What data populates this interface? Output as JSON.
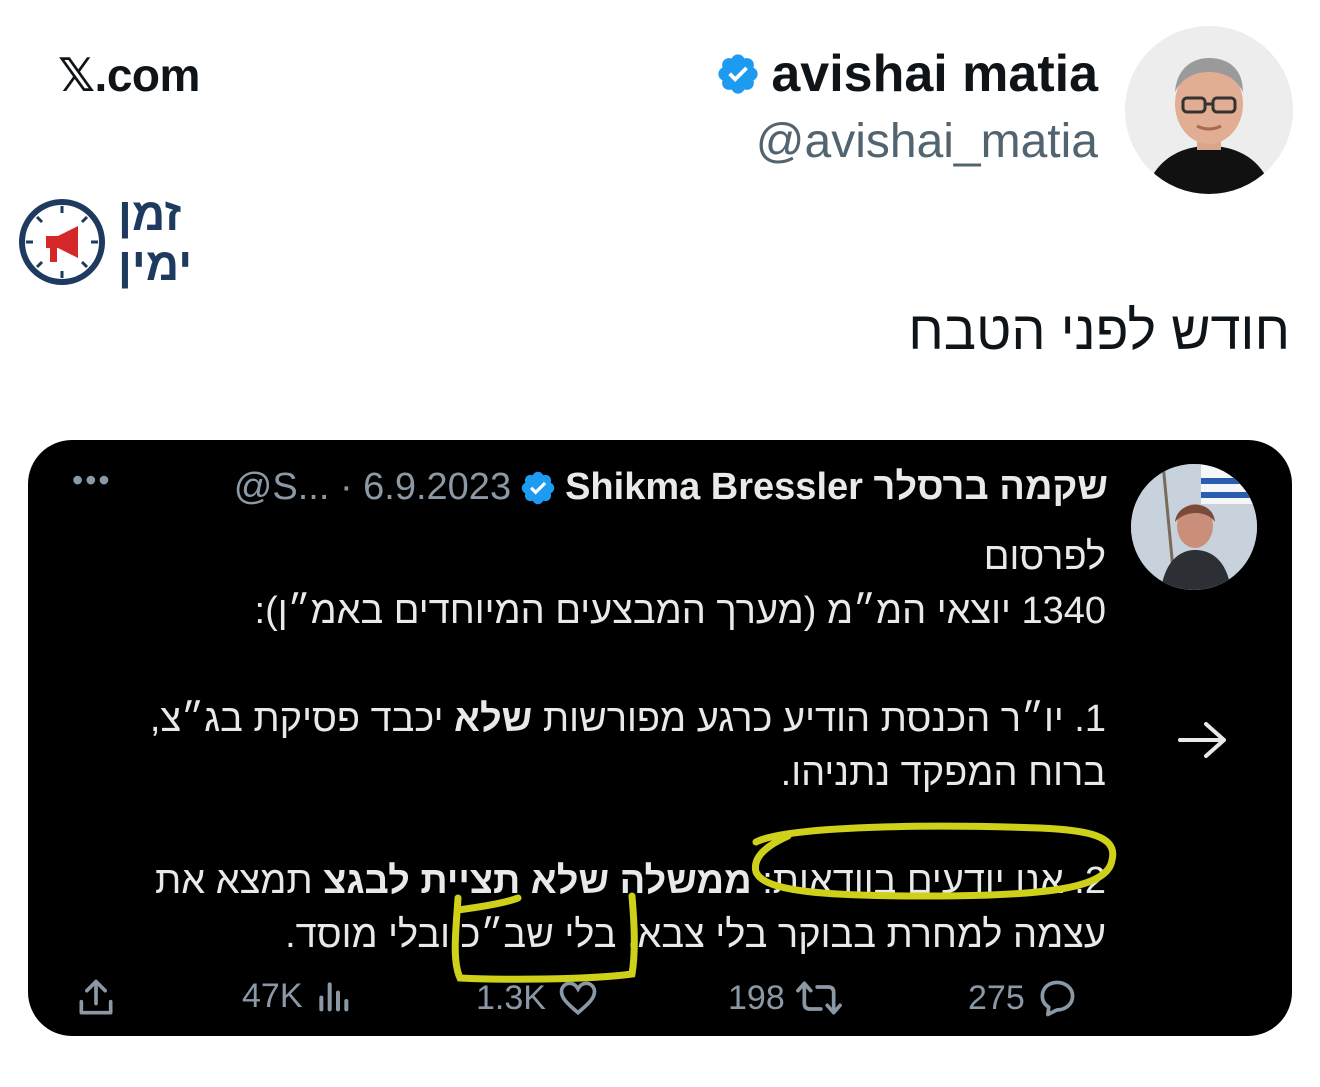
{
  "site": {
    "label": "𝕏.com"
  },
  "author": {
    "name": "avishai matia",
    "handle": "@avishai_matia",
    "avatar_icon": "person-avatar-icon",
    "verified_icon": "verified-badge-icon",
    "badge_color": "#1d9bf0"
  },
  "brand": {
    "logo_text_top": "זמן",
    "logo_text_bottom": "ימין",
    "logo_icon": "megaphone-clock-icon",
    "color": "#1e3a5f",
    "accent": "#d62828"
  },
  "post": {
    "text": "חודש לפני הטבח"
  },
  "quote": {
    "name": "שקמה ברסלר Shikma Bressler",
    "meta": "@S... · 6.9.2023",
    "more": "•••",
    "lines": {
      "l1": "לפרסום",
      "l2": "1340 יוצאי המ״מ (מערך המבצעים המיוחדים באמ״ן):",
      "p1_prefix": "1. יו״ר הכנסת הודיע כרגע מפורשות ",
      "p1_bold": "שלא",
      "p1_suffix": " יכבד פסיקת בג״צ,",
      "p1_line2": "ברוח המפקד נתניהו.",
      "p2_prefix": "2. אנו יודעים בוודאות: ",
      "p2_bold": "ממשלה שלא תציית לבגצ",
      "p2_suffix": " תמצא את",
      "p2_line2": "עצמה למחרת בבוקר בלי צבא, בלי שב״כ ובלי מוסד."
    },
    "highlight_color": "#cfd01a"
  },
  "actions": {
    "replies": "275",
    "reposts": "198",
    "likes": "1.3K",
    "views": "47K"
  }
}
